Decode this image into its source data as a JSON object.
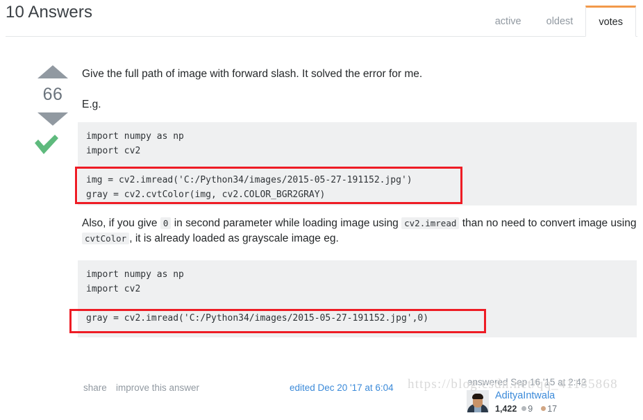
{
  "header": {
    "title": "10 Answers",
    "tabs": [
      {
        "label": "active",
        "selected": false
      },
      {
        "label": "oldest",
        "selected": false
      },
      {
        "label": "votes",
        "selected": true
      }
    ]
  },
  "answer": {
    "vote_count": "66",
    "accepted": true,
    "accept_icon": "checkmark-icon",
    "upvote_icon": "arrow-up-icon",
    "downvote_icon": "arrow-down-icon",
    "paragraph_1": "Give the full path of image with forward slash. It solved the error for me.",
    "paragraph_2": "E.g.",
    "code_block_1": "import numpy as np\nimport cv2\n\nimg = cv2.imread('C:/Python34/images/2015-05-27-191152.jpg')\ngray = cv2.cvtColor(img, cv2.COLOR_BGR2GRAY)",
    "paragraph_3": {
      "t1": "Also, if you give ",
      "c1": "0",
      "t2": " in second parameter while loading image using ",
      "c2": "cv2.imread",
      "t3": " than no need to convert image using ",
      "c3": "cvtColor",
      "t4": ", it is already loaded as grayscale image eg."
    },
    "code_block_2": "import numpy as np\nimport cv2\n\ngray = cv2.imread('C:/Python34/images/2015-05-27-191152.jpg',0)",
    "footer": {
      "share": "share",
      "improve": "improve this answer",
      "edited": "edited Dec 20 '17 at 6:04",
      "answered": "answered Sep 16 '15 at 2:42"
    },
    "user": {
      "name": "AdityaIntwala",
      "reputation": "1,422",
      "silver_badges": "9",
      "bronze_badges": "17",
      "avatar_alt": "user-avatar"
    }
  },
  "watermark": "https://blog.csdn.net/qq_41185868",
  "colors": {
    "accent_orange": "#f2994a",
    "link_blue": "#3b8ad9",
    "accept_green": "#5eba7d",
    "annotation_red": "#ee1c25",
    "code_bg": "#eff0f1",
    "muted_text": "#9199a1"
  }
}
